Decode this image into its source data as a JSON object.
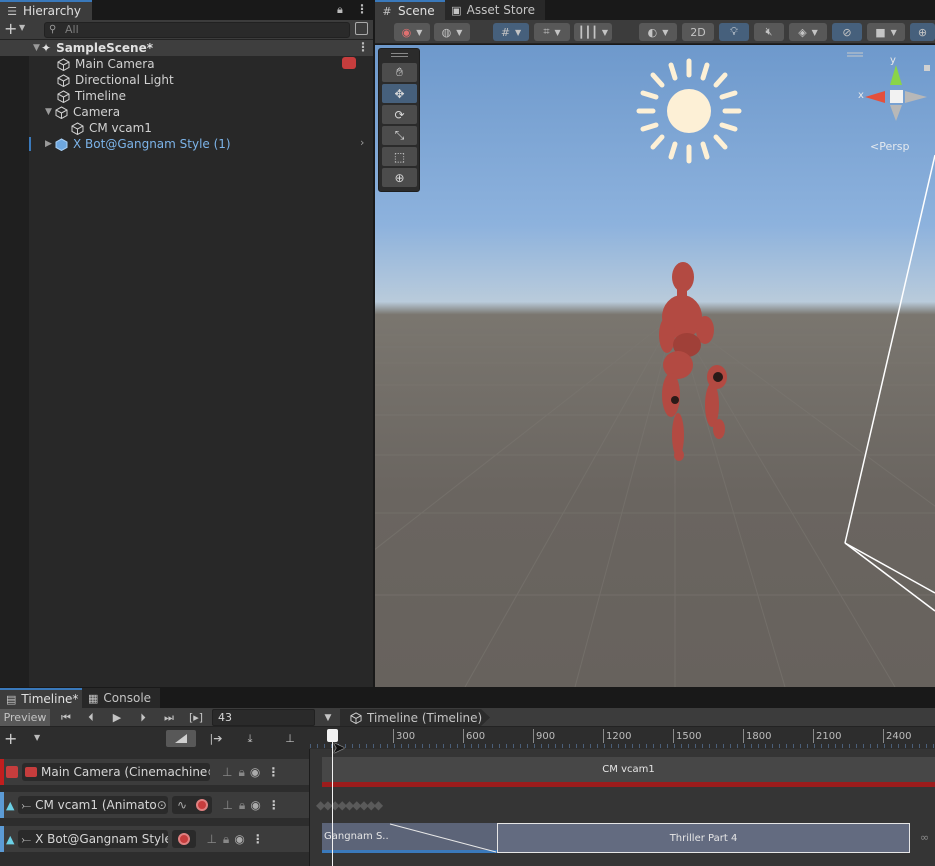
{
  "hierarchy": {
    "tab_label": "Hierarchy",
    "search_placeholder": "All",
    "items": [
      {
        "label": "SampleScene*"
      },
      {
        "label": "Main Camera"
      },
      {
        "label": "Directional Light"
      },
      {
        "label": "Timeline"
      },
      {
        "label": "Camera"
      },
      {
        "label": "CM vcam1"
      },
      {
        "label": "X Bot@Gangnam Style (1)"
      }
    ]
  },
  "scene": {
    "tabs": [
      {
        "label": "Scene"
      },
      {
        "label": "Asset Store"
      }
    ],
    "toolbar": {
      "mode_2d": "2D"
    },
    "gizmo": {
      "persp_label": "<Persp",
      "y_label": "y",
      "x_label": "x"
    },
    "tools": [
      "hand-tool",
      "move-tool",
      "rotate-tool",
      "scale-tool",
      "rect-tool",
      "transform-tool"
    ]
  },
  "timeline": {
    "tabs": [
      {
        "label": "Timeline*"
      },
      {
        "label": "Console"
      }
    ],
    "preview_label": "Preview",
    "frame_value": "43",
    "breadcrumb": "Timeline (Timeline)",
    "ruler": [
      "300",
      "600",
      "900",
      "1200",
      "1500",
      "1800",
      "2100",
      "2400"
    ],
    "tracks": [
      {
        "label": "Main Camera (Cinemachine",
        "clip": "CM vcam1"
      },
      {
        "label": "CM vcam1 (Animato"
      },
      {
        "label": "X Bot@Gangnam Style",
        "clips": [
          "Gangnam S..",
          "Thriller Part 4"
        ]
      }
    ]
  },
  "colors": {
    "accent": "#3a79bb",
    "selection": "#46607c",
    "record_red": "#c63d3d"
  }
}
